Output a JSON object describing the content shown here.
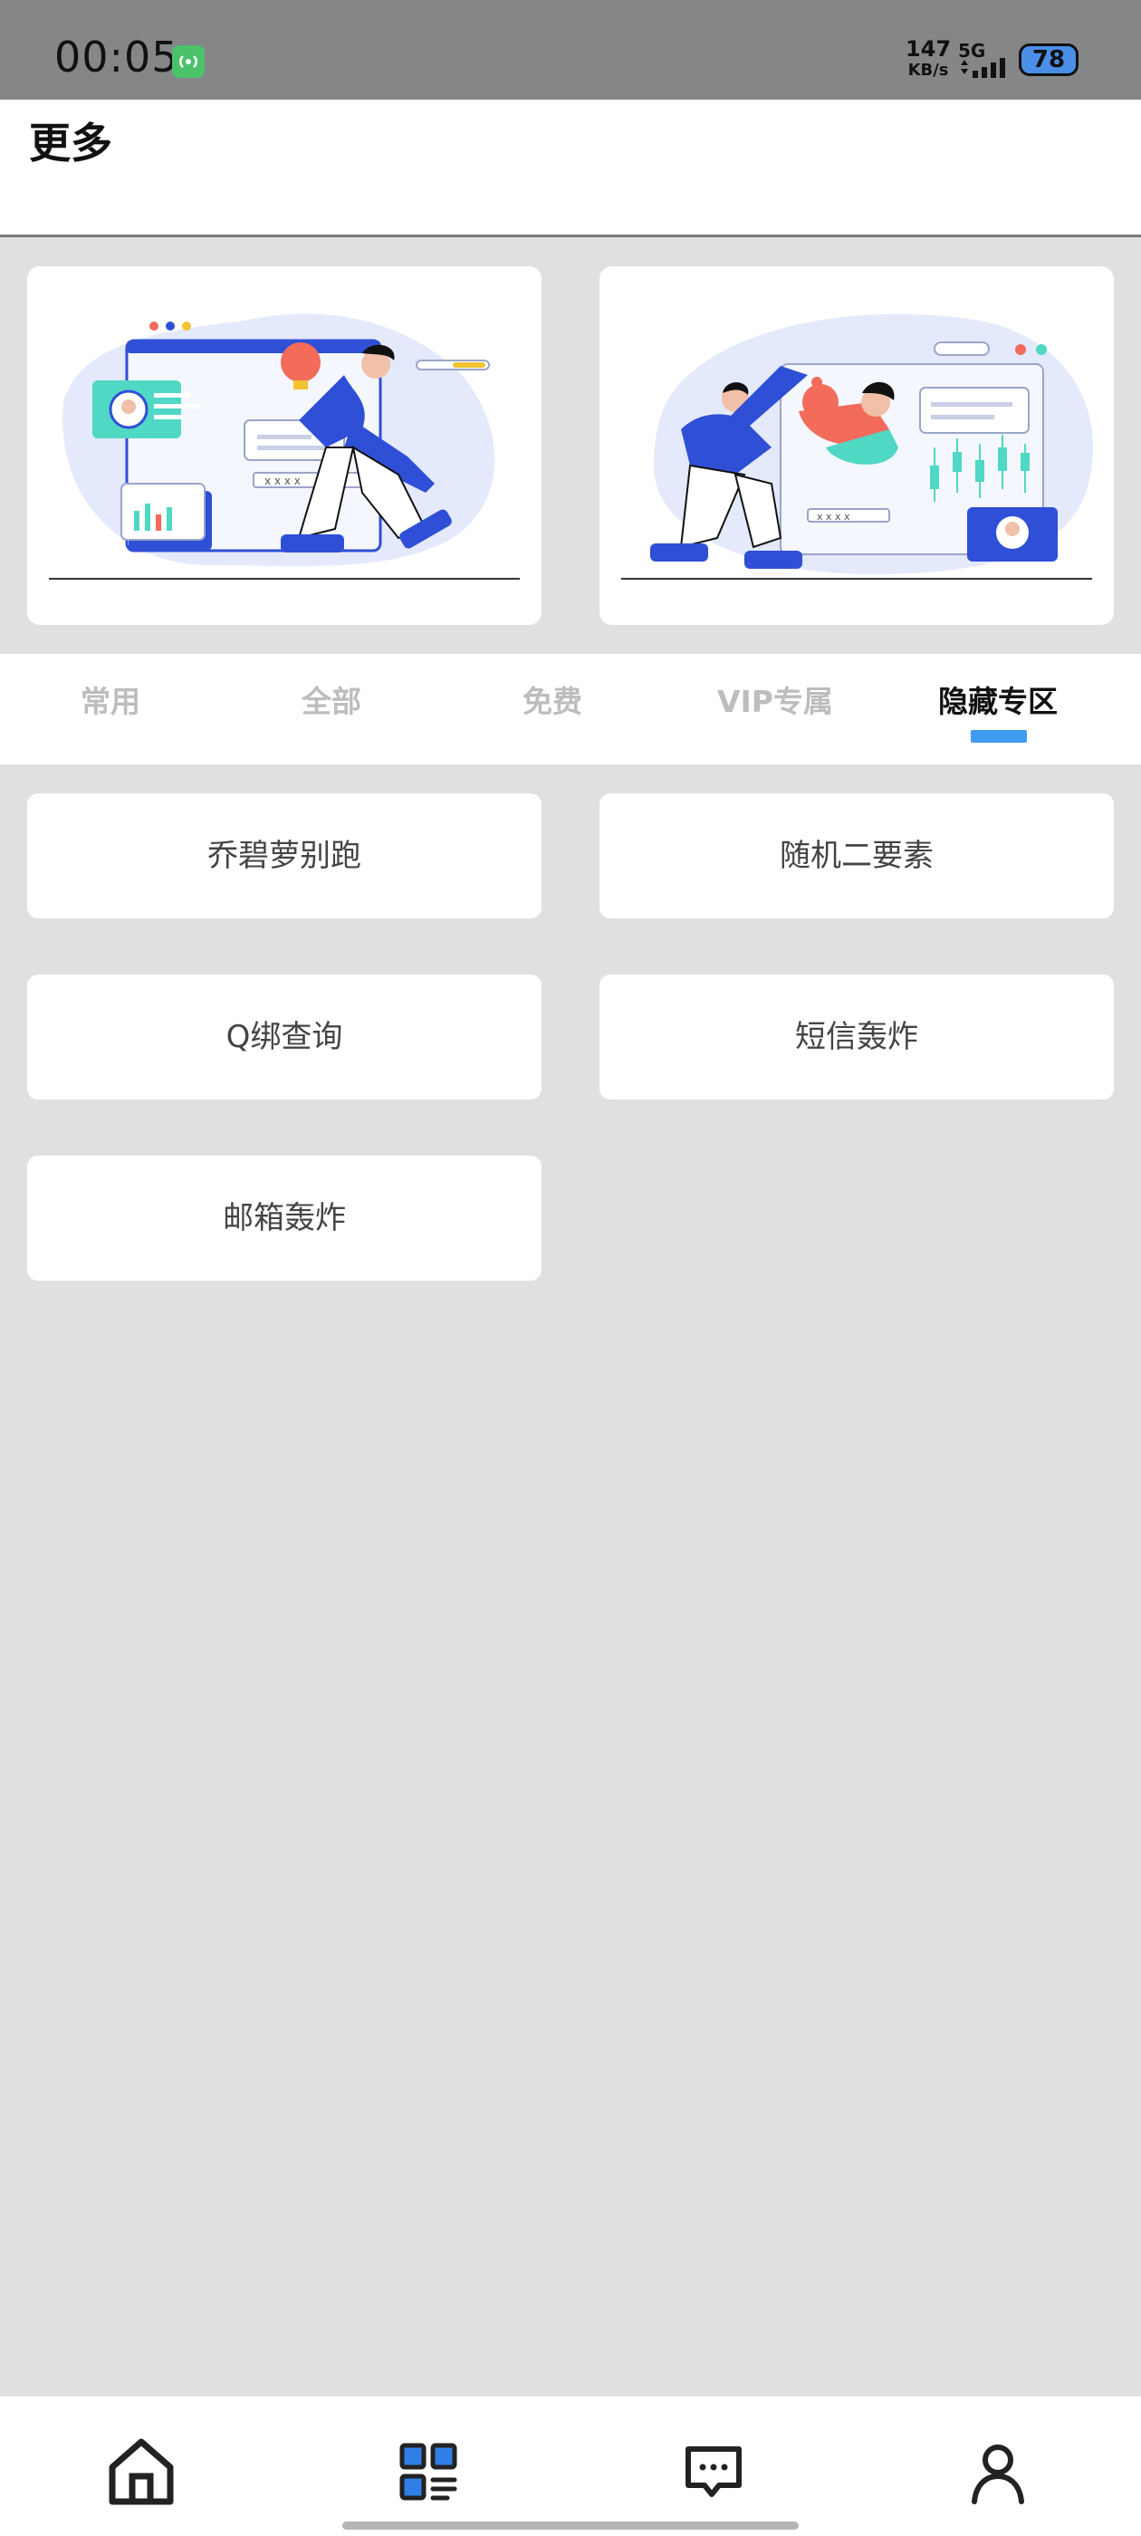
{
  "status_bar": {
    "time": "00:05",
    "speed_value": "147",
    "speed_unit": "KB/s",
    "network": "5G",
    "battery": "78",
    "hotspot_icon": "hotspot-icon"
  },
  "header": {
    "title": "更多"
  },
  "banners": [
    {
      "icon": "illustration-person-lightbulb"
    },
    {
      "icon": "illustration-people-dashboard"
    }
  ],
  "tabs": [
    {
      "label": "常用",
      "active": false
    },
    {
      "label": "全部",
      "active": false
    },
    {
      "label": "免费",
      "active": false
    },
    {
      "label": "VIP专属",
      "active": false
    },
    {
      "label": "隐藏专区",
      "active": true
    }
  ],
  "items": [
    {
      "label": "乔碧萝别跑"
    },
    {
      "label": "随机二要素"
    },
    {
      "label": "Q绑查询"
    },
    {
      "label": "短信轰炸"
    },
    {
      "label": "邮箱轰炸"
    }
  ],
  "bottom_nav": [
    {
      "icon": "home-icon",
      "active": false
    },
    {
      "icon": "apps-icon",
      "active": true
    },
    {
      "icon": "message-icon",
      "active": false
    },
    {
      "icon": "profile-icon",
      "active": false
    }
  ],
  "colors": {
    "accent": "#3f9cf0",
    "status_bar": "#858688",
    "background": "#e0e0e0",
    "illustration_blue": "#2f4fd6",
    "illustration_teal": "#4fd8c4",
    "illustration_coral": "#f26b5b"
  }
}
